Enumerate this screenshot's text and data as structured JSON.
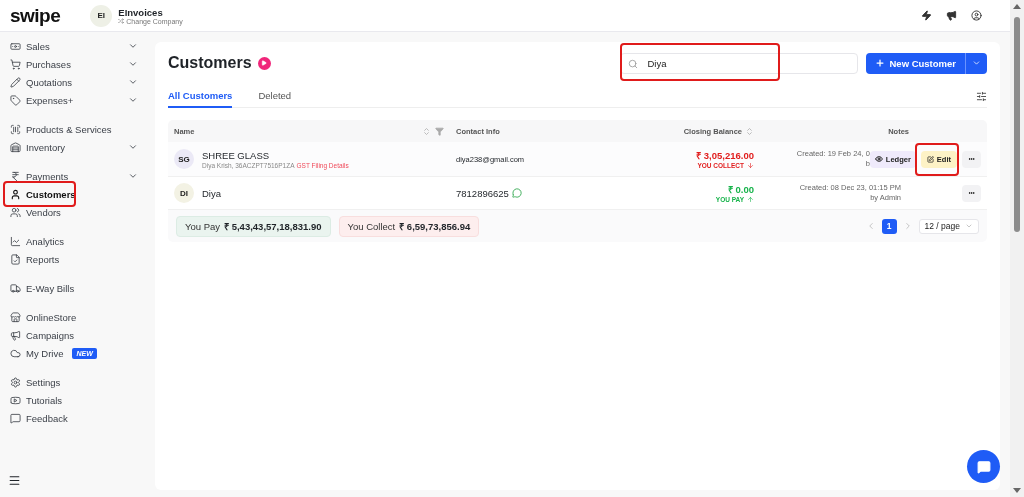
{
  "header": {
    "logo": "swipe",
    "company": {
      "initials": "EI",
      "name": "EInvoices",
      "action": "Change Company"
    }
  },
  "sidebar": {
    "groups": [
      {
        "items": [
          {
            "label": "Sales",
            "expandable": true,
            "selected": false,
            "highlighted": false
          },
          {
            "label": "Purchases",
            "expandable": true,
            "selected": false,
            "highlighted": false
          },
          {
            "label": "Quotations",
            "expandable": true,
            "selected": false,
            "highlighted": false
          },
          {
            "label": "Expenses+",
            "expandable": true,
            "selected": false,
            "highlighted": false
          }
        ]
      },
      {
        "items": [
          {
            "label": "Products & Services",
            "expandable": false,
            "selected": false,
            "highlighted": false
          },
          {
            "label": "Inventory",
            "expandable": true,
            "selected": false,
            "highlighted": false
          }
        ]
      },
      {
        "items": [
          {
            "label": "Payments",
            "expandable": true,
            "selected": false,
            "highlighted": false
          },
          {
            "label": "Customers",
            "expandable": false,
            "selected": true,
            "highlighted": true
          },
          {
            "label": "Vendors",
            "expandable": false,
            "selected": false,
            "highlighted": false
          }
        ]
      },
      {
        "items": [
          {
            "label": "Analytics",
            "expandable": false,
            "selected": false,
            "highlighted": false
          },
          {
            "label": "Reports",
            "expandable": false,
            "selected": false,
            "highlighted": false
          }
        ]
      },
      {
        "items": [
          {
            "label": "E-Way Bills",
            "expandable": false,
            "selected": false,
            "highlighted": false
          }
        ]
      },
      {
        "items": [
          {
            "label": "OnlineStore",
            "expandable": false,
            "selected": false,
            "highlighted": false
          },
          {
            "label": "Campaigns",
            "expandable": false,
            "selected": false,
            "highlighted": false
          },
          {
            "label": "My Drive",
            "expandable": false,
            "selected": false,
            "highlighted": false,
            "badge": "NEW"
          }
        ]
      },
      {
        "items": [
          {
            "label": "Settings",
            "expandable": false,
            "selected": false,
            "highlighted": false
          },
          {
            "label": "Tutorials",
            "expandable": false,
            "selected": false,
            "highlighted": false
          },
          {
            "label": "Feedback",
            "expandable": false,
            "selected": false,
            "highlighted": false
          }
        ]
      }
    ]
  },
  "page": {
    "title": "Customers",
    "search": {
      "value": "Diya",
      "highlighted": true
    },
    "new_button": "New Customer",
    "tabs": [
      {
        "label": "All Customers",
        "selected": true
      },
      {
        "label": "Deleted",
        "selected": false
      }
    ]
  },
  "table": {
    "columns": [
      "Name",
      "Contact Info",
      "Closing Balance",
      "Notes"
    ],
    "rows": [
      {
        "initials": "SG",
        "color": "#ebe9f6",
        "name": "SHREE GLASS",
        "details": "Diya Krish, 36ACZPT7516P1ZA",
        "link": "GST Filing Details",
        "contact": {
          "kind": "email",
          "text": "diya238@gmail.com"
        },
        "balance": {
          "kind": "collect",
          "amount": "₹ 3,05,216.00",
          "label": "YOU COLLECT"
        },
        "notes": [
          "Created: 19 Feb 24, 0",
          "b"
        ],
        "hovered": true,
        "ledger": "Ledger",
        "edit": {
          "label": "Edit",
          "highlighted": true
        }
      },
      {
        "initials": "DI",
        "color": "#f3f2e4",
        "name": "Diya",
        "contact": {
          "kind": "phone",
          "text": "7812896625"
        },
        "balance": {
          "kind": "pay",
          "amount": "₹ 0.00",
          "label": "YOU PAY"
        },
        "notes": [
          "Created: 08 Dec 23, 01:15 PM",
          "by Admin"
        ],
        "hovered": false
      }
    ],
    "summary": [
      {
        "label": "You Pay",
        "amount": "₹ 5,43,43,57,18,831.90",
        "kind": "pay"
      },
      {
        "label": "You Collect",
        "amount": "₹ 6,59,73,856.94",
        "kind": "collect"
      }
    ],
    "pagination": {
      "pages": [
        {
          "label": "1",
          "selected": true
        }
      ],
      "page_size": "12 / page"
    }
  }
}
